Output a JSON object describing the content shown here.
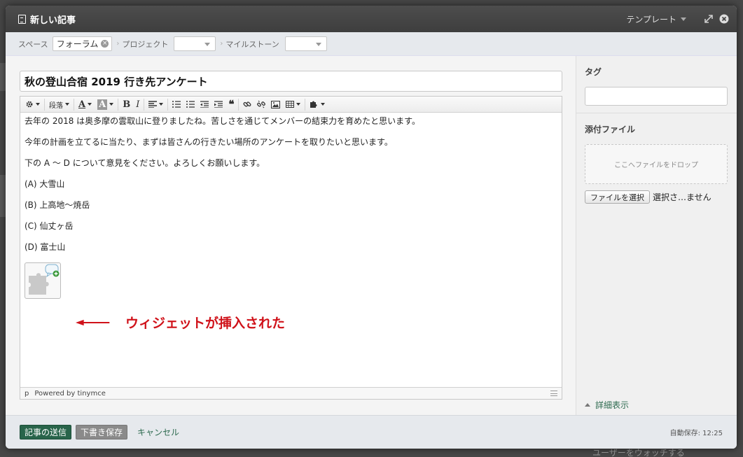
{
  "modal": {
    "title": "新しい記事",
    "template_label": "テンプレート"
  },
  "meta": {
    "space_label": "スペース",
    "space_value": "フォーラム",
    "project_label": "プロジェクト",
    "milestone_label": "マイルストーン"
  },
  "article": {
    "title": "秋の登山合宿 2019 行き先アンケート",
    "lines": [
      "去年の 2018 は奥多摩の雲取山に登りましたね。苦しさを通じてメンバーの結束力を育めたと思います。",
      "今年の計画を立てるに当たり、まずは皆さんの行きたい場所のアンケートを取りたいと思います。",
      "下の A 〜 D について意見をください。よろしくお願いします。",
      "(A) 大雪山",
      "(B) 上高地〜焼岳",
      "(C) 仙丈ヶ岳",
      "(D) 富士山"
    ]
  },
  "toolbar": {
    "format_label": "段落"
  },
  "statusbar": {
    "path": "p",
    "powered": "Powered by tinymce"
  },
  "annotation": {
    "text": "ウィジェットが挿入された",
    "color": "#d0121a"
  },
  "sidebar": {
    "tags_heading": "タグ",
    "attachments_heading": "添付ファイル",
    "dropzone_text": "ここへファイルをドロップ",
    "file_button": "ファイルを選択",
    "file_status": "選択さ…ません",
    "detail_link": "詳細表示"
  },
  "footer": {
    "submit": "記事の送信",
    "draft": "下書き保存",
    "cancel": "キャンセル",
    "autosave": "自動保存: 12:25"
  },
  "backdrop": {
    "footer_text": "ユーザーをウォッチする"
  },
  "colors": {
    "primary": "#28644a",
    "link": "#2d6a4f",
    "titlebar": "#444444"
  }
}
